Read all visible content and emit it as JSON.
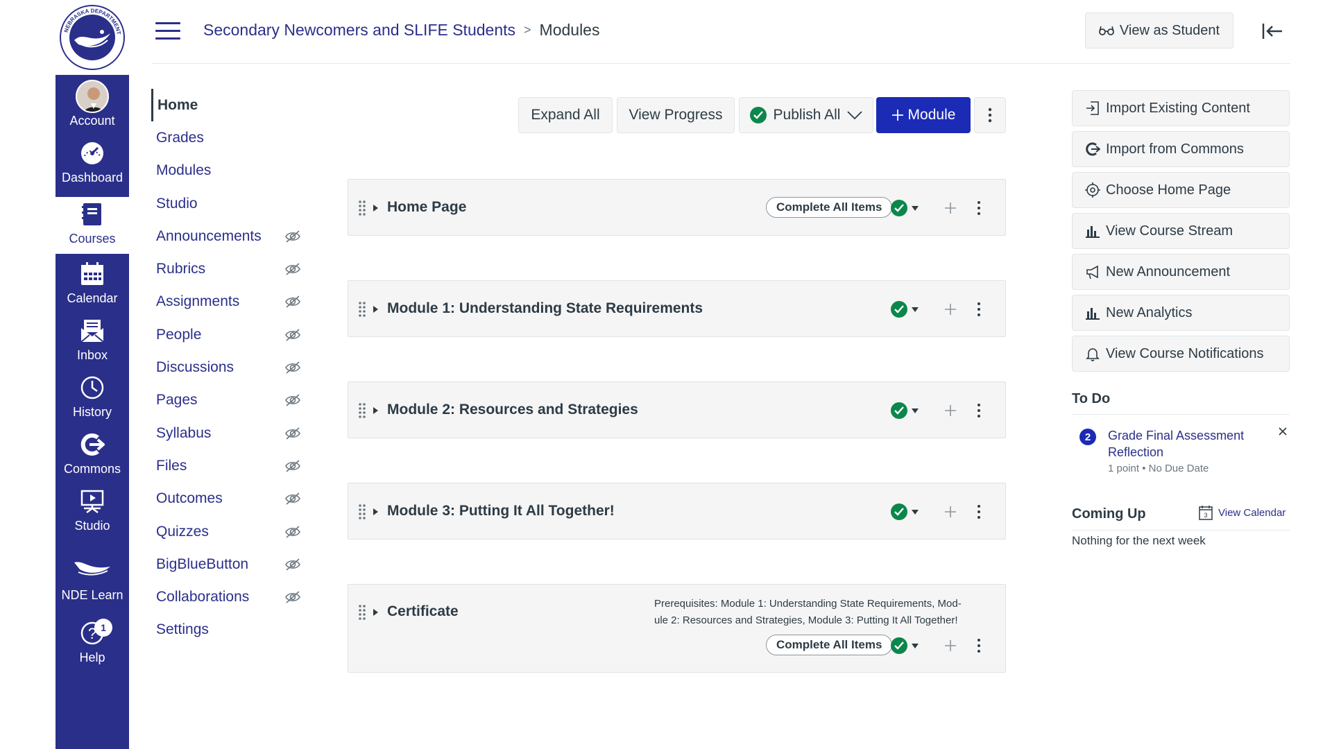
{
  "global_nav": {
    "items": [
      {
        "label": "Account"
      },
      {
        "label": "Dashboard"
      },
      {
        "label": "Courses"
      },
      {
        "label": "Calendar"
      },
      {
        "label": "Inbox"
      },
      {
        "label": "History"
      },
      {
        "label": "Commons"
      },
      {
        "label": "Studio"
      },
      {
        "label": "NDE Learn"
      },
      {
        "label": "Help",
        "badge": "1"
      }
    ],
    "logo_text_top": "NEBRASKA DEPARTMENT",
    "logo_text_bottom": "OF EDUCATION",
    "active": "Courses"
  },
  "header": {
    "course": "Secondary Newcomers and SLIFE Students",
    "separator": ">",
    "page": "Modules",
    "view_as_student": "View as Student"
  },
  "course_nav": [
    {
      "label": "Home",
      "hidden": false
    },
    {
      "label": "Grades",
      "hidden": false
    },
    {
      "label": "Modules",
      "hidden": false
    },
    {
      "label": "Studio",
      "hidden": false
    },
    {
      "label": "Announcements",
      "hidden": true
    },
    {
      "label": "Rubrics",
      "hidden": true
    },
    {
      "label": "Assignments",
      "hidden": true
    },
    {
      "label": "People",
      "hidden": true
    },
    {
      "label": "Discussions",
      "hidden": true
    },
    {
      "label": "Pages",
      "hidden": true
    },
    {
      "label": "Syllabus",
      "hidden": true
    },
    {
      "label": "Files",
      "hidden": true
    },
    {
      "label": "Outcomes",
      "hidden": true
    },
    {
      "label": "Quizzes",
      "hidden": true
    },
    {
      "label": "BigBlueButton",
      "hidden": true
    },
    {
      "label": "Collaborations",
      "hidden": true
    },
    {
      "label": "Settings",
      "hidden": false
    }
  ],
  "toolbar": {
    "expand_all": "Expand All",
    "view_progress": "View Progress",
    "publish_all": "Publish All",
    "add_module": "Module"
  },
  "modules": [
    {
      "title": "Home Page",
      "requirement": "Complete All Items",
      "prerequisites": ""
    },
    {
      "title": "Module 1: Understanding State Requirements",
      "requirement": "",
      "prerequisites": ""
    },
    {
      "title": "Module 2: Resources and Strategies",
      "requirement": "",
      "prerequisites": ""
    },
    {
      "title": "Module 3: Putting It All Together!",
      "requirement": "",
      "prerequisites": ""
    },
    {
      "title": "Certificate",
      "requirement": "Complete All Items",
      "prerequisites_line1": "Prerequisites: Module 1: Understanding State Requirements, Mod-",
      "prerequisites_line2": "ule 2: Resources and Strategies, Module 3: Putting It All Together!"
    }
  ],
  "sidebar": {
    "buttons": [
      {
        "label": "Import Existing Content",
        "icon": "import-icon"
      },
      {
        "label": "Import from Commons",
        "icon": "commons-icon"
      },
      {
        "label": "Choose Home Page",
        "icon": "target-icon"
      },
      {
        "label": "View Course Stream",
        "icon": "bar-chart-icon"
      },
      {
        "label": "New Announcement",
        "icon": "megaphone-icon"
      },
      {
        "label": "New Analytics",
        "icon": "bar-chart-icon"
      },
      {
        "label": "View Course Notifications",
        "icon": "bell-icon"
      }
    ],
    "todo": {
      "heading": "To Do",
      "item_badge": "2",
      "item_title_1": "Grade Final Assessment",
      "item_title_2": "Reflection",
      "item_meta": "1 point • No Due Date"
    },
    "coming_up": {
      "heading": "Coming Up",
      "calendar_icon_day": "3",
      "view_calendar": "View Calendar",
      "empty": "Nothing for the next week"
    }
  },
  "colors": {
    "nav_bg": "#2a2f8a",
    "link": "#2a2f8a",
    "primary_button": "#1b2bb5",
    "published_green": "#0b874b"
  }
}
